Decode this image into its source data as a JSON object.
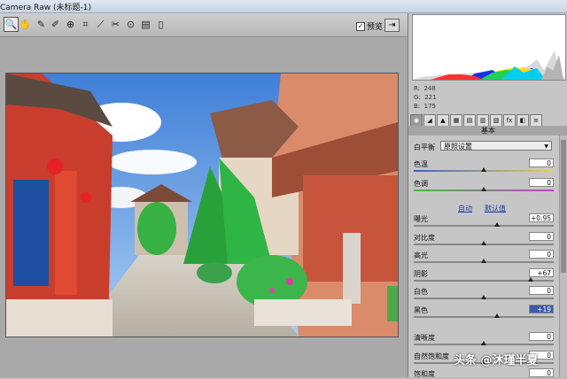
{
  "window": {
    "title": "Camera Raw (未标题-1)"
  },
  "toolbar": {
    "tools": [
      {
        "icon": "zoom-icon",
        "glyph": "🔍"
      },
      {
        "icon": "hand-icon",
        "glyph": "✋"
      },
      {
        "icon": "white-balance-icon",
        "glyph": "✎"
      },
      {
        "icon": "color-sampler-icon",
        "glyph": "✐"
      },
      {
        "icon": "target-adjust-icon",
        "glyph": "⊕"
      },
      {
        "icon": "crop-icon",
        "glyph": "⌗"
      },
      {
        "icon": "straighten-icon",
        "glyph": "⟋"
      },
      {
        "icon": "spot-removal-icon",
        "glyph": "✂"
      },
      {
        "icon": "red-eye-icon",
        "glyph": "⊙"
      },
      {
        "icon": "adjustment-brush-icon",
        "glyph": "▤"
      },
      {
        "icon": "graduated-filter-icon",
        "glyph": "▯"
      }
    ],
    "preview_label": "预览",
    "preview_checked": "✓",
    "expand_glyph": "⇥"
  },
  "readout": {
    "r": "R:  248",
    "g": "G:  221",
    "b": "B:  175"
  },
  "panel": {
    "section_title": "基本",
    "tab_glyphs": [
      "◉",
      "◢",
      "▲",
      "▦",
      "▤",
      "▥",
      "▧",
      "fx",
      "◧",
      "≡"
    ],
    "white_balance": {
      "label": "白平衡",
      "value": "原照设置"
    },
    "auto_link": "自动",
    "default_link": "默认值",
    "sliders": [
      {
        "label": "色温",
        "value": "0"
      },
      {
        "label": "色调",
        "value": "0"
      },
      {
        "label": "曝光",
        "value": "+0.95"
      },
      {
        "label": "对比度",
        "value": "0"
      },
      {
        "label": "高光",
        "value": "0"
      },
      {
        "label": "阴影",
        "value": "+67"
      },
      {
        "label": "白色",
        "value": "0"
      },
      {
        "label": "黑色",
        "value": "+19"
      },
      {
        "label": "清晰度",
        "value": "0"
      },
      {
        "label": "自然饱和度",
        "value": "0"
      },
      {
        "label": "饱和度",
        "value": "0"
      }
    ]
  },
  "watermark": "头条 @沐瑾半夏",
  "colors": {
    "accent": "#3a5ba8",
    "panel_bg": "#c6c6c6",
    "canvas_bg": "#a9a9a9"
  }
}
